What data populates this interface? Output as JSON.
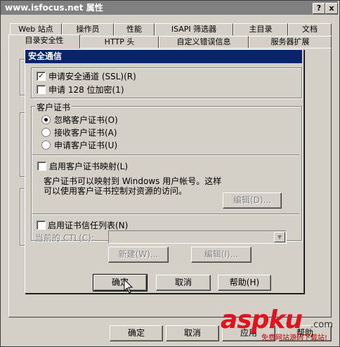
{
  "window": {
    "title": "www.isfocus.net 属性",
    "help_button": "?",
    "close_button": "x"
  },
  "tabs_row1": [
    "Web 站点",
    "操作员",
    "性能",
    "ISAPI 筛选器",
    "主目录",
    "文档"
  ],
  "tabs_row2": [
    "目录安全性",
    "HTTP 头",
    "自定义错误信息",
    "服务器扩展"
  ],
  "dialog": {
    "title": "安全通信",
    "require_ssl": {
      "label": "申请安全通道 (SSL)(R)",
      "checked": true
    },
    "require_128": {
      "label": "申请 128 位加密(1)",
      "checked": false
    },
    "client_cert_group": "客户证书",
    "radios": [
      {
        "label": "忽略客户证书(O)",
        "selected": true
      },
      {
        "label": "接收客户证书(A)",
        "selected": false
      },
      {
        "label": "申请客户证书(U)",
        "selected": false
      }
    ],
    "enable_mapping": {
      "label": "启用客户证书映射(L)",
      "checked": false
    },
    "mapping_desc_1": "客户证书可以映射到 Windows 用户帐号。这样",
    "mapping_desc_2": "可以使用客户证书控制对资源的访问。",
    "edit_mapping_button": "编辑(D)...",
    "enable_ctl": {
      "label": "启用证书信任列表(N)",
      "checked": false
    },
    "current_ctl_label": "当前的 CTL(C):",
    "current_ctl_value": "",
    "new_button": "新建(W)...",
    "edit_ctl_button": "编辑(I)...",
    "ok_button": "确定",
    "cancel_button": "取消",
    "help_button": "帮助(H)"
  },
  "footer": {
    "ok_button": "确定",
    "cancel_button": "取消",
    "apply_button": "应用",
    "help_button": "帮助"
  },
  "watermark": {
    "logo": "aspku",
    "suffix": ".com",
    "tagline": "免费网站源码下载站!"
  }
}
